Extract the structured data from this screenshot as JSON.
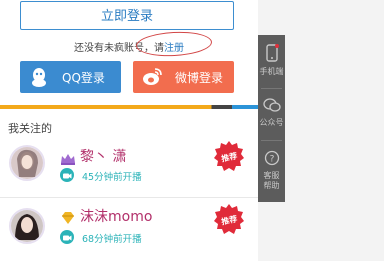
{
  "login": {
    "button_label": "立即登录",
    "register_prompt": "还没有未疯账号，请",
    "register_link": "注册"
  },
  "social": {
    "qq_label": "QQ登录",
    "weibo_label": "微博登录"
  },
  "follow_section": {
    "title": "我关注的",
    "entries": [
      {
        "name": "黎丶 潇",
        "status": "45分钟前开播",
        "badge": "推荐"
      },
      {
        "name": "沫沫momo",
        "status": "68分钟前开播",
        "badge": "推荐"
      }
    ]
  },
  "sidebar": {
    "items": [
      {
        "label": "手机端",
        "icon": "phone-icon"
      },
      {
        "label": "公众号",
        "icon": "wechat-icon"
      },
      {
        "label": "客服帮助",
        "icon": "help-icon"
      }
    ]
  },
  "colors": {
    "accent_blue": "#3b8bd0",
    "weibo_orange": "#f26d4e",
    "name_pink": "#b2306a",
    "teal": "#2bb3b8",
    "seal_red": "#e02b3a",
    "sidebar_dark": "#5c5c5c"
  }
}
